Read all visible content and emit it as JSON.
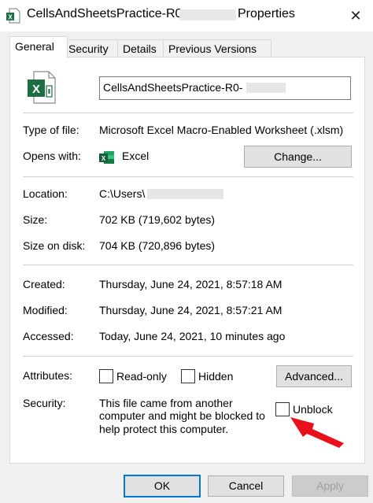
{
  "window": {
    "title_prefix": "CellsAndSheetsPractice-R0-",
    "title_suffix": "Properties",
    "close_glyph": "✕",
    "icon": "excel-file-icon"
  },
  "tabs": [
    {
      "label": "General",
      "active": true
    },
    {
      "label": "Security"
    },
    {
      "label": "Details"
    },
    {
      "label": "Previous Versions"
    }
  ],
  "general": {
    "filename": "CellsAndSheetsPractice-R0-",
    "type_label": "Type of file:",
    "type_value": "Microsoft Excel Macro-Enabled Worksheet (.xlsm)",
    "opens_label": "Opens with:",
    "opens_value": "Excel",
    "change_button": "Change...",
    "location_label": "Location:",
    "location_value": "C:\\Users\\",
    "size_label": "Size:",
    "size_value": "702 KB (719,602 bytes)",
    "size_disk_label": "Size on disk:",
    "size_disk_value": "704 KB (720,896 bytes)",
    "created_label": "Created:",
    "created_value": "Thursday, June 24, 2021, 8:57:18 AM",
    "modified_label": "Modified:",
    "modified_value": "Thursday, June 24, 2021, 8:57:21 AM",
    "accessed_label": "Accessed:",
    "accessed_value": "Today, June 24, 2021, 10 minutes ago",
    "attributes_label": "Attributes:",
    "readonly_label": "Read-only",
    "hidden_label": "Hidden",
    "advanced_button": "Advanced...",
    "security_label": "Security:",
    "security_text_1": "This file came from another",
    "security_text_2": "computer and might be blocked to",
    "security_text_3": "help protect this computer.",
    "unblock_label": "Unblock"
  },
  "footer": {
    "ok": "OK",
    "cancel": "Cancel",
    "apply": "Apply"
  },
  "colors": {
    "excel_green": "#1d6f42",
    "arrow_red": "#e8111b",
    "accent_blue": "#0078d7"
  }
}
